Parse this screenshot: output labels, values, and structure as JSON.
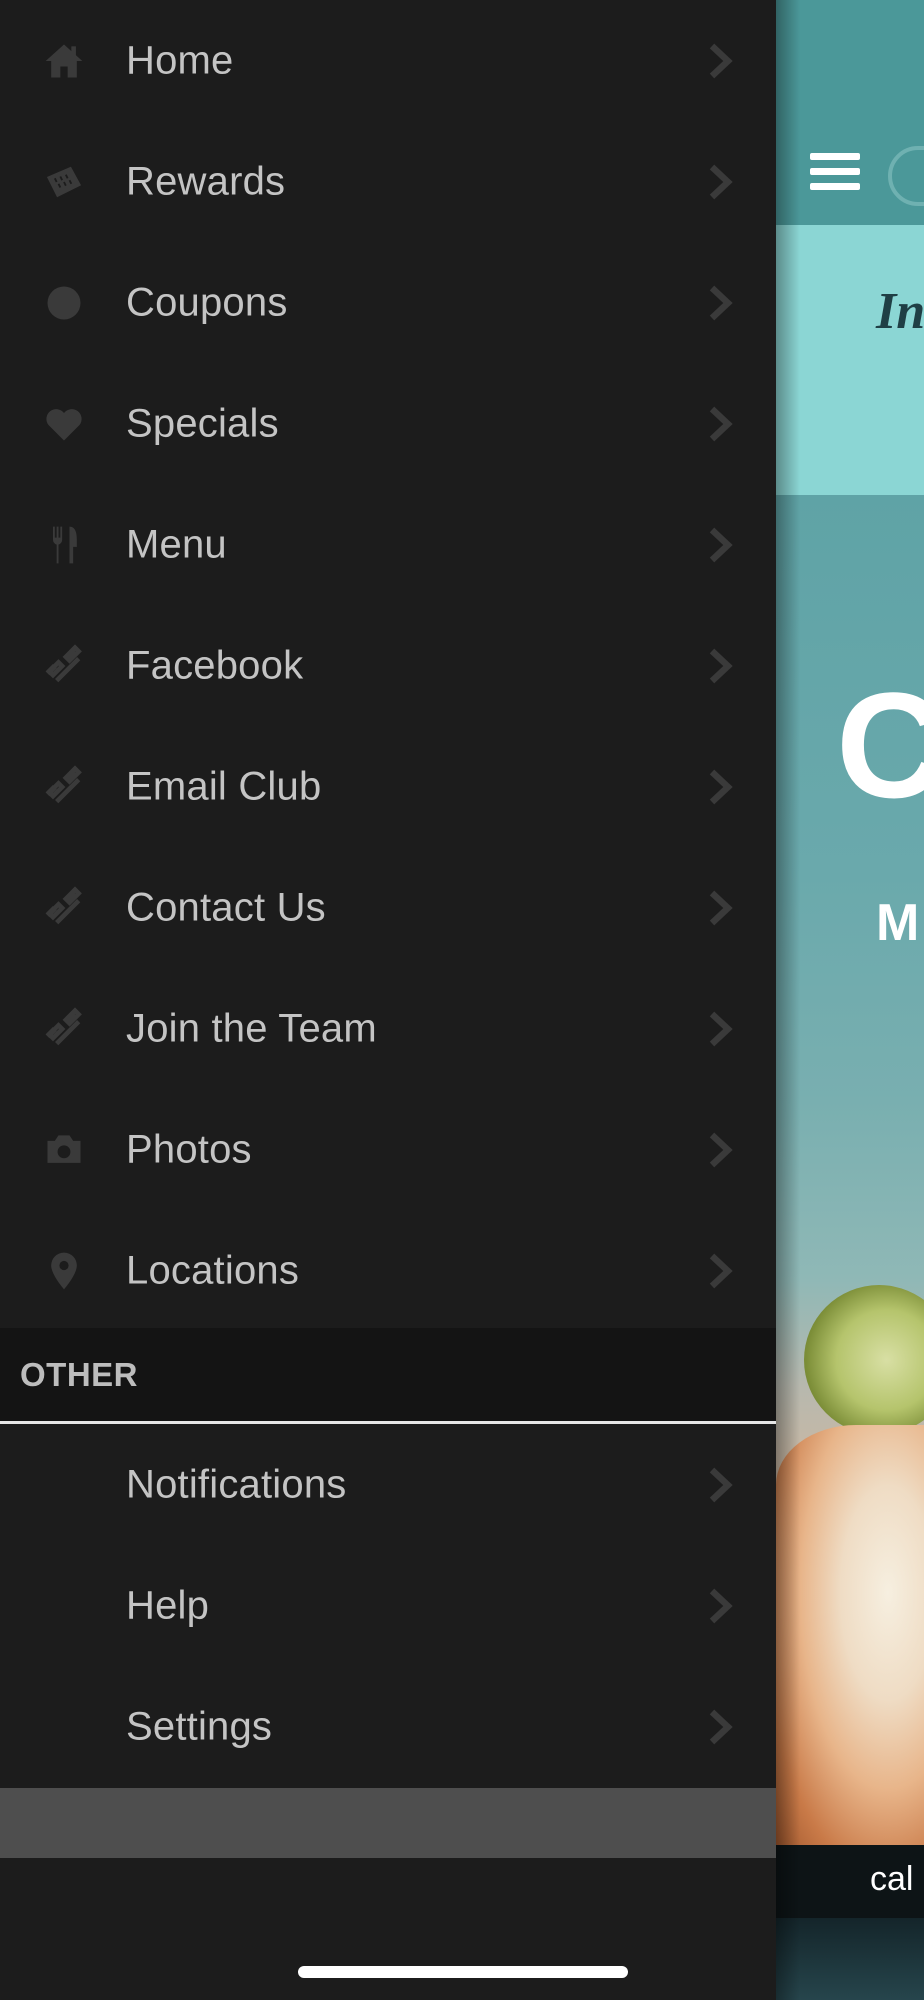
{
  "menu": {
    "items": [
      {
        "label": "Home",
        "icon": "home-icon"
      },
      {
        "label": "Rewards",
        "icon": "ticket-icon"
      },
      {
        "label": "Coupons",
        "icon": "circle-icon"
      },
      {
        "label": "Specials",
        "icon": "heart-icon"
      },
      {
        "label": "Menu",
        "icon": "fork-knife-icon"
      },
      {
        "label": "Facebook",
        "icon": "link-icon"
      },
      {
        "label": "Email Club",
        "icon": "link-icon"
      },
      {
        "label": "Contact Us",
        "icon": "link-icon"
      },
      {
        "label": "Join the Team",
        "icon": "link-icon"
      },
      {
        "label": "Photos",
        "icon": "camera-icon"
      },
      {
        "label": "Locations",
        "icon": "map-pin-icon"
      }
    ]
  },
  "other": {
    "header": "OTHER",
    "items": [
      {
        "label": "Notifications"
      },
      {
        "label": "Help"
      },
      {
        "label": "Settings"
      }
    ]
  },
  "background_app": {
    "banner_text": "In",
    "hero_big": "C",
    "hero_small": "M",
    "footer_text": "cal"
  },
  "colors": {
    "drawer_bg": "#1c1c1c",
    "label": "#c4c4c4",
    "icon": "#3a3a3a",
    "header_bg": "#141414",
    "teal": "#4b9899"
  }
}
